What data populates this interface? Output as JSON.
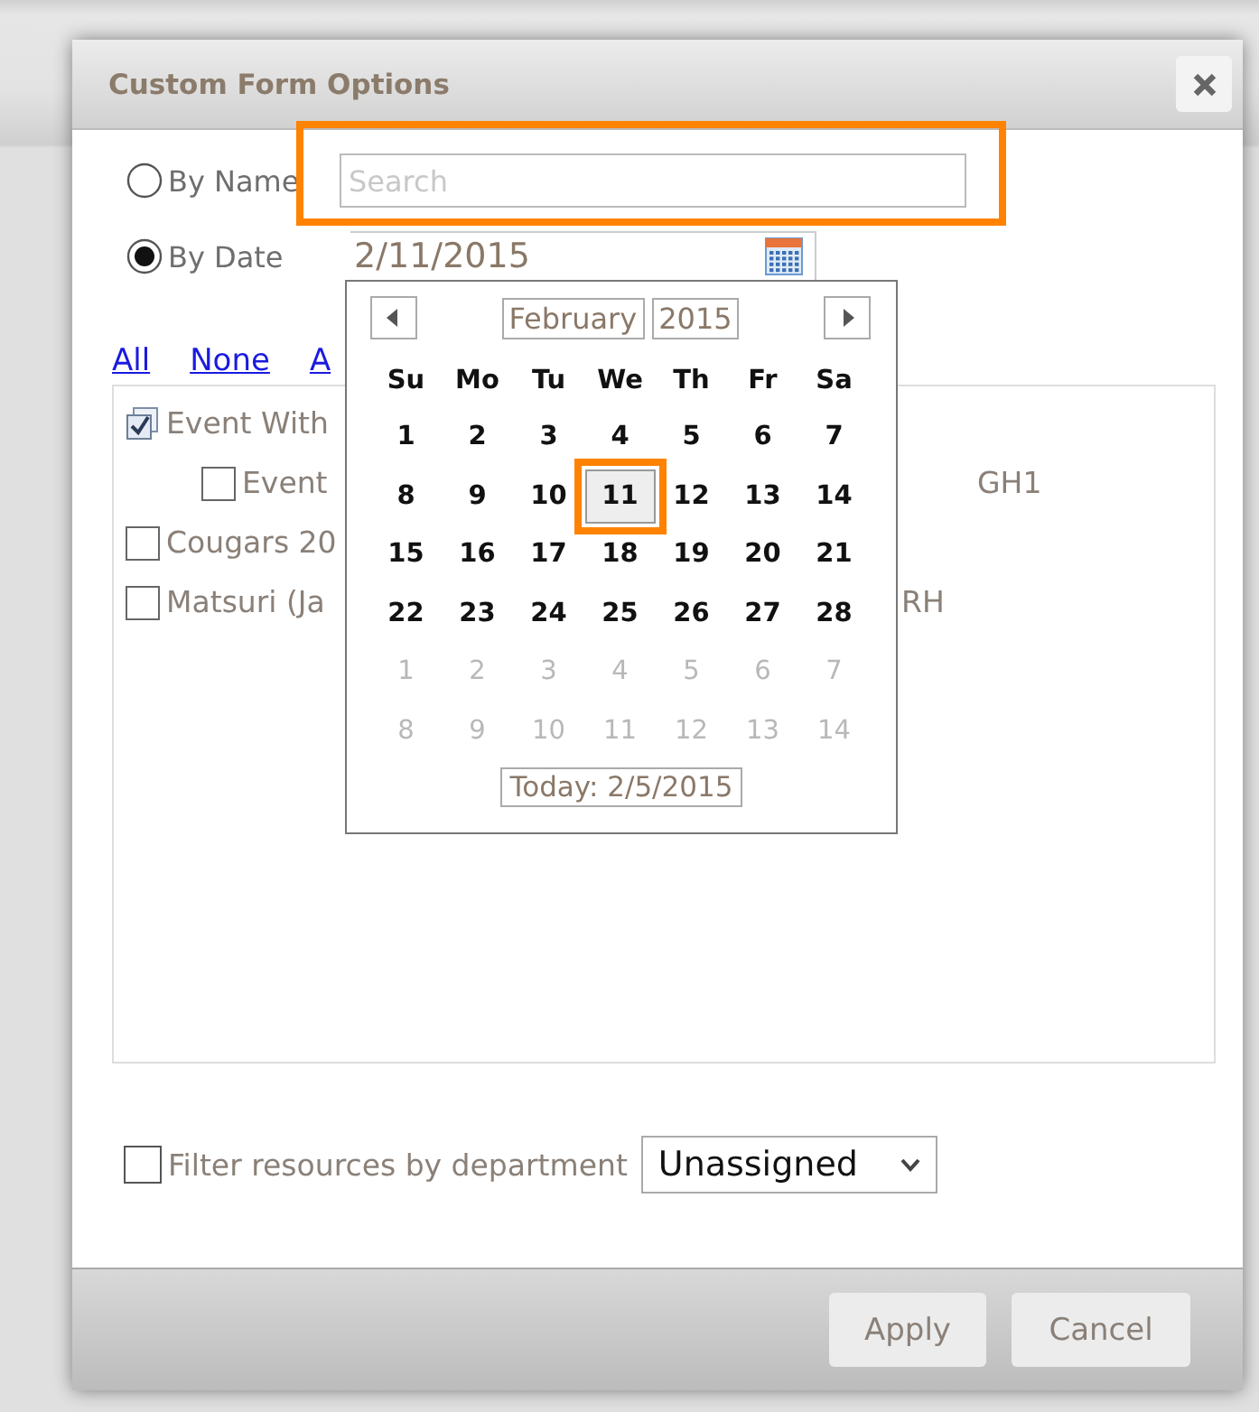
{
  "window": {
    "title": "Custom Form Options"
  },
  "search_mode": [
    {
      "label": "By Name",
      "selected": false
    },
    {
      "label": "By Date",
      "selected": true
    }
  ],
  "search_field": {
    "placeholder": "Search",
    "highlighted": true
  },
  "date_field": {
    "value": "2/11/2015"
  },
  "calendar": {
    "month": "February",
    "year": "2015",
    "weekdays": [
      "Su",
      "Mo",
      "Tu",
      "We",
      "Th",
      "Fr",
      "Sa"
    ],
    "days": [
      {
        "label": "1",
        "other_month": false,
        "selected": false
      },
      {
        "label": "2",
        "other_month": false,
        "selected": false
      },
      {
        "label": "3",
        "other_month": false,
        "selected": false
      },
      {
        "label": "4",
        "other_month": false,
        "selected": false
      },
      {
        "label": "5",
        "other_month": false,
        "selected": false
      },
      {
        "label": "6",
        "other_month": false,
        "selected": false
      },
      {
        "label": "7",
        "other_month": false,
        "selected": false
      },
      {
        "label": "8",
        "other_month": false,
        "selected": false
      },
      {
        "label": "9",
        "other_month": false,
        "selected": false
      },
      {
        "label": "10",
        "other_month": false,
        "selected": false
      },
      {
        "label": "11",
        "other_month": false,
        "selected": true
      },
      {
        "label": "12",
        "other_month": false,
        "selected": false
      },
      {
        "label": "13",
        "other_month": false,
        "selected": false
      },
      {
        "label": "14",
        "other_month": false,
        "selected": false
      },
      {
        "label": "15",
        "other_month": false,
        "selected": false
      },
      {
        "label": "16",
        "other_month": false,
        "selected": false
      },
      {
        "label": "17",
        "other_month": false,
        "selected": false
      },
      {
        "label": "18",
        "other_month": false,
        "selected": false
      },
      {
        "label": "19",
        "other_month": false,
        "selected": false
      },
      {
        "label": "20",
        "other_month": false,
        "selected": false
      },
      {
        "label": "21",
        "other_month": false,
        "selected": false
      },
      {
        "label": "22",
        "other_month": false,
        "selected": false
      },
      {
        "label": "23",
        "other_month": false,
        "selected": false
      },
      {
        "label": "24",
        "other_month": false,
        "selected": false
      },
      {
        "label": "25",
        "other_month": false,
        "selected": false
      },
      {
        "label": "26",
        "other_month": false,
        "selected": false
      },
      {
        "label": "27",
        "other_month": false,
        "selected": false
      },
      {
        "label": "28",
        "other_month": false,
        "selected": false
      },
      {
        "label": "1",
        "other_month": true,
        "selected": false
      },
      {
        "label": "2",
        "other_month": true,
        "selected": false
      },
      {
        "label": "3",
        "other_month": true,
        "selected": false
      },
      {
        "label": "4",
        "other_month": true,
        "selected": false
      },
      {
        "label": "5",
        "other_month": true,
        "selected": false
      },
      {
        "label": "6",
        "other_month": true,
        "selected": false
      },
      {
        "label": "7",
        "other_month": true,
        "selected": false
      },
      {
        "label": "8",
        "other_month": true,
        "selected": false
      },
      {
        "label": "9",
        "other_month": true,
        "selected": false
      },
      {
        "label": "10",
        "other_month": true,
        "selected": false
      },
      {
        "label": "11",
        "other_month": true,
        "selected": false
      },
      {
        "label": "12",
        "other_month": true,
        "selected": false
      },
      {
        "label": "13",
        "other_month": true,
        "selected": false
      },
      {
        "label": "14",
        "other_month": true,
        "selected": false
      }
    ],
    "today": "Today: 2/5/2015"
  },
  "links": [
    "All",
    "None",
    "A"
  ],
  "items": [
    {
      "label": "Event With",
      "checked": true,
      "children": [
        {
          "label": "Event",
          "checked": false,
          "trailing": "GH1"
        }
      ]
    },
    {
      "label": "Cougars 20",
      "checked": false
    },
    {
      "label": "Matsuri (Ja",
      "checked": false,
      "trailing": "RH"
    }
  ],
  "filter": {
    "label": "Filter resources by department",
    "checked": false,
    "department": "Unassigned"
  },
  "buttons": [
    "Apply",
    "Cancel"
  ]
}
